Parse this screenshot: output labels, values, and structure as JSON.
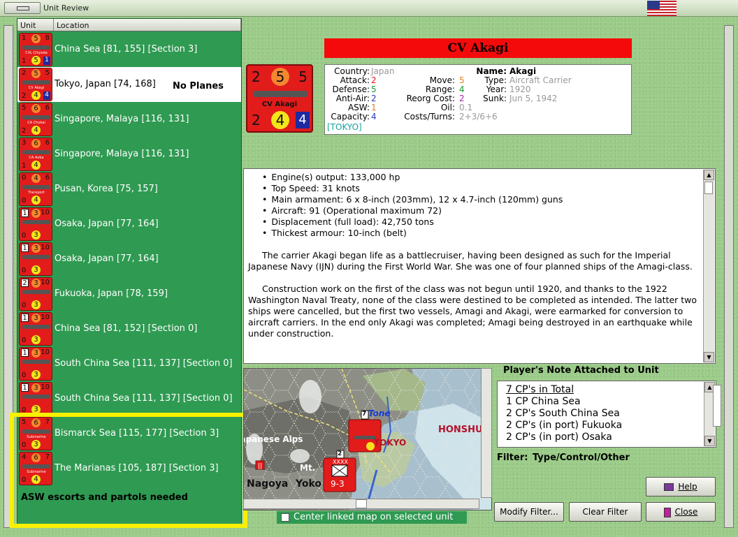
{
  "window": {
    "title": "Unit Review"
  },
  "columns": {
    "unit": "Unit",
    "location": "Location"
  },
  "units": [
    {
      "loc": "China Sea [81, 155] [Section 3]",
      "a": "1",
      "b": "5",
      "c": "8",
      "d": "1",
      "e": "5",
      "f": "1",
      "nm": "CVL Chiyoda"
    },
    {
      "loc": "Tokyo, Japan [74, 168]",
      "a": "2",
      "b": "5",
      "c": "5",
      "d": "2",
      "e": "4",
      "f": "4",
      "nm": "CV Akagi",
      "note": "No Planes"
    },
    {
      "loc": "Singapore, Malaya [116, 131]",
      "a": "5",
      "b": "6",
      "c": "6",
      "d": "2",
      "e": "4",
      "f": "",
      "nm": "CA Chokai"
    },
    {
      "loc": "Singapore, Malaya [116, 131]",
      "a": "3",
      "b": "6",
      "c": "6",
      "d": "1",
      "e": "4",
      "f": "",
      "nm": "CA Aoba"
    },
    {
      "loc": "Pusan, Korea [75, 157]",
      "a": "0",
      "b": "4",
      "c": "6",
      "d": "0",
      "e": "4",
      "f": "",
      "nm": "Transport"
    },
    {
      "loc": "Osaka, Japan [77, 164]",
      "a": "1",
      "b": "3",
      "c": "10",
      "d": "0",
      "e": "3",
      "f": "",
      "nm": ""
    },
    {
      "loc": "Osaka, Japan [77, 164]",
      "a": "1",
      "b": "3",
      "c": "10",
      "d": "0",
      "e": "3",
      "f": "",
      "nm": ""
    },
    {
      "loc": "Fukuoka, Japan [78, 159]",
      "a": "2",
      "b": "3",
      "c": "10",
      "d": "0",
      "e": "3",
      "f": "",
      "nm": ""
    },
    {
      "loc": "China Sea [81, 152] [Section 0]",
      "a": "1",
      "b": "3",
      "c": "10",
      "d": "0",
      "e": "3",
      "f": "",
      "nm": ""
    },
    {
      "loc": "South China Sea [111, 137] [Section 0]",
      "a": "1",
      "b": "3",
      "c": "10",
      "d": "0",
      "e": "3",
      "f": "",
      "nm": ""
    },
    {
      "loc": "South China Sea [111, 137] [Section 0]",
      "a": "1",
      "b": "3",
      "c": "10",
      "d": "0",
      "e": "3",
      "f": "",
      "nm": ""
    },
    {
      "loc": "Bismarck Sea [115, 177] [Section 3]",
      "a": "5",
      "b": "6",
      "c": "7",
      "d": "0",
      "e": "3",
      "f": "",
      "nm": "Submarine"
    },
    {
      "loc": "The Marianas [105, 187] [Section 3]",
      "a": "4",
      "b": "6",
      "c": "7",
      "d": "0",
      "e": "4",
      "f": "",
      "nm": "Submarine"
    }
  ],
  "highlight_note": "ASW escorts and partols needed",
  "selected": {
    "title": "CV Akagi",
    "counter": {
      "a": "2",
      "b": "5",
      "c": "5",
      "d": "2",
      "e": "4",
      "f": "4",
      "nm": "CV Akagi"
    },
    "country_label": "Country:",
    "country": "Japan",
    "attack_label": "Attack:",
    "attack": "2",
    "defense_label": "Defense:",
    "defense": "5",
    "antiair_label": "Anti-Air:",
    "antiair": "2",
    "asw_label": "ASW:",
    "asw": "1",
    "capacity_label": "Capacity:",
    "capacity": "4",
    "port": "[TOKYO]",
    "move_label": "Move:",
    "move": "5",
    "range_label": "Range:",
    "range": "4",
    "reorg_label": "Reorg Cost:",
    "reorg": "2",
    "oil_label": "Oil:",
    "oil": "0.1",
    "costs_label": "Costs/Turns:",
    "costs": "2+3/6+6",
    "name_label": "Name:",
    "name": "Akagi",
    "type_label": "Type:",
    "type": "Aircraft Carrier",
    "year_label": "Year:",
    "year": "1920",
    "sunk_label": "Sunk:",
    "sunk": "Jun 5, 1942"
  },
  "description": {
    "bullets": [
      "Engine(s) output: 133,000 hp",
      "Top Speed: 31 knots",
      "Main armament: 6 x 8-inch (203mm), 12 x 4.7-inch (120mm) guns",
      "Aircraft: 91 (Operational maximum 72)",
      "Displacement (full load): 42,750 tons",
      "Thickest armour: 10-inch (belt)"
    ],
    "p1": "The carrier Akagi began life as a battlecruiser, having been designed as such for the Imperial Japanese Navy (IJN) during the First World War.  She was one of four planned ships of the Amagi-class.",
    "p2": "Construction work on the first of the class was not begun until 1920, and thanks to the 1922 Washington Naval Treaty, none of the class were destined to be completed as intended.  The latter two ships were cancelled, but the first two vessels, Amagi and Akagi, were earmarked for conversion to aircraft carriers. In the end only Akagi was completed; Amagi being destroyed in an earthquake while under construction."
  },
  "map": {
    "labels": [
      "Tone",
      "HONSHU",
      "TOKYO",
      "Japanese Alps",
      "Mt.",
      "Nagoya",
      "Yoko"
    ],
    "unit_counter": "9-3",
    "unit_top": "XXXX",
    "unit_num": "7",
    "unit_num2": "2"
  },
  "center_map_label": "Center linked map on selected unit",
  "note_header": "Player's Note Attached to Unit",
  "note_lines": [
    "7 CP's in Total",
    "1 CP China Sea",
    "2 CP's South China Sea",
    "2 CP's (in port) Fukuoka",
    "2 CP's (in port) Osaka"
  ],
  "filter": "Filter:   Type/Control/Other",
  "buttons": {
    "help": "Help",
    "modify": "Modify Filter...",
    "clear": "Clear Filter",
    "close": "Close"
  }
}
